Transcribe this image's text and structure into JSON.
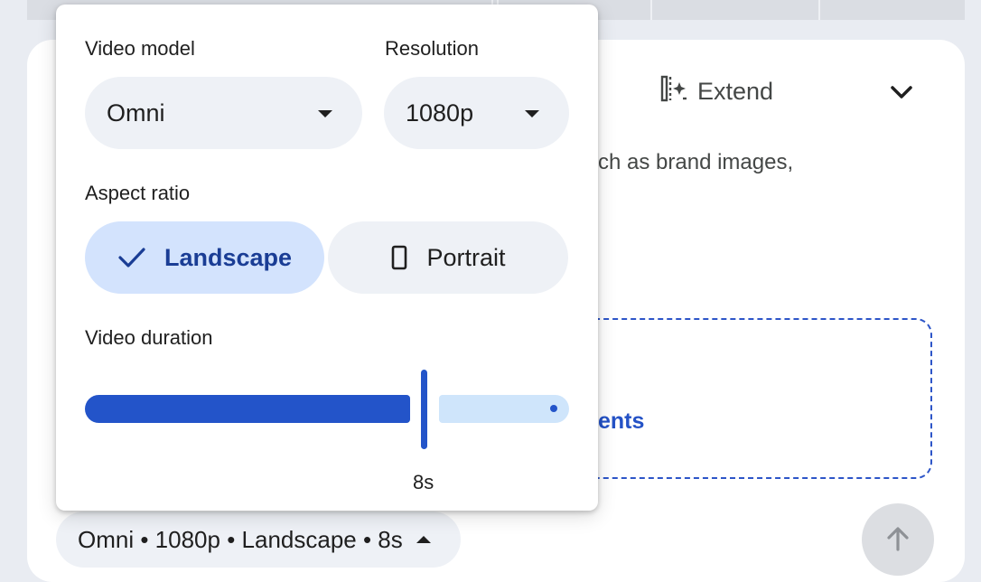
{
  "background": {
    "extend_label": "Extend",
    "hint_text": "ch as brand images,",
    "dropzone_text": "ents"
  },
  "popover": {
    "video_model": {
      "label": "Video model",
      "value": "Omni"
    },
    "resolution": {
      "label": "Resolution",
      "value": "1080p"
    },
    "aspect_ratio": {
      "label": "Aspect ratio",
      "options": [
        {
          "label": "Landscape",
          "selected": true
        },
        {
          "label": "Portrait",
          "selected": false
        }
      ]
    },
    "video_duration": {
      "label": "Video duration",
      "value_label": "8s",
      "fraction": 0.71
    }
  },
  "summary_chip": {
    "label": "Omni • 1080p • Landscape • 8s"
  },
  "colors": {
    "accent": "#2354c9",
    "accent_light": "#d3e3fd",
    "track_inactive": "#cfe5fb",
    "chip_bg": "#eef1f6"
  },
  "icons": {
    "extend": "extend-frame-sparkle-icon",
    "chevron": "chevron-down-icon",
    "dropdown": "arrow-drop-down-icon",
    "check": "check-icon",
    "portrait": "portrait-phone-icon",
    "send": "arrow-up-icon",
    "collapse": "arrow-drop-up-icon"
  }
}
